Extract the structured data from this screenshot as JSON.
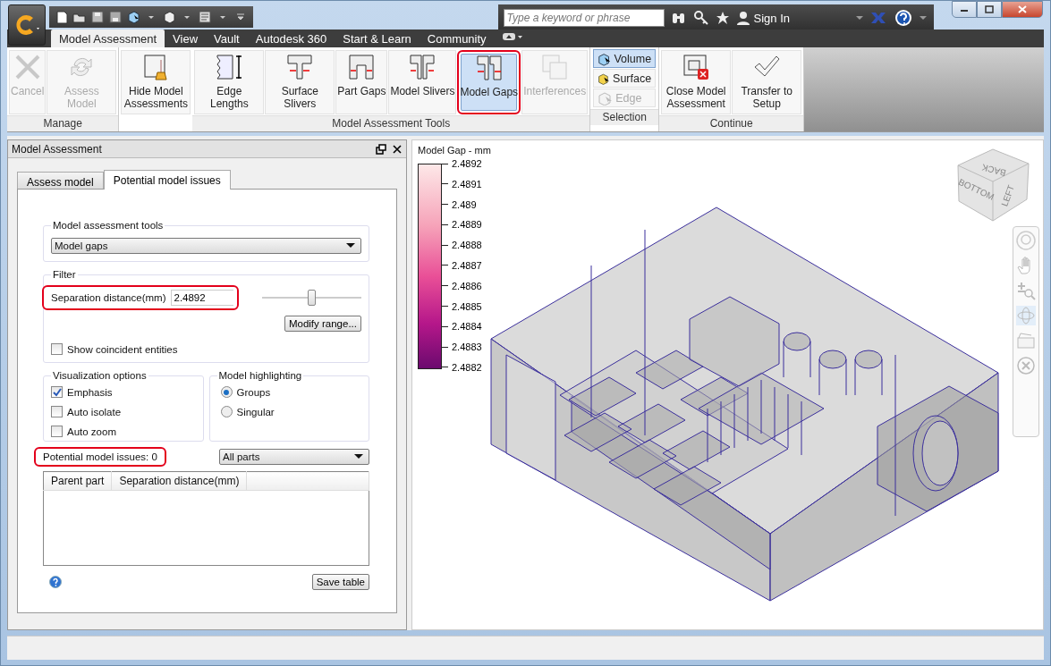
{
  "title_bar": {
    "search": {
      "placeholder": "Type a keyword or phrase"
    },
    "sign_in": "Sign In"
  },
  "ribbon_tabs": [
    {
      "label": "Model Assessment",
      "selected": true
    },
    {
      "label": "View",
      "selected": false
    },
    {
      "label": "Vault",
      "selected": false
    },
    {
      "label": "Autodesk 360",
      "selected": false
    },
    {
      "label": "Start & Learn",
      "selected": false
    },
    {
      "label": "Community",
      "selected": false
    }
  ],
  "ribbon_groups": [
    {
      "title": "Manage",
      "buttons": [
        {
          "kind": "large",
          "label": "Cancel",
          "disabled": true,
          "selected": false,
          "highlighted": false
        },
        {
          "kind": "large",
          "label": "Assess Model",
          "disabled": true,
          "selected": false,
          "highlighted": false
        }
      ]
    },
    {
      "buttons": [
        {
          "kind": "large",
          "label": "Hide Model Assessments",
          "disabled": false,
          "selected": false,
          "highlighted": false
        }
      ]
    },
    {
      "title": "Model Assessment Tools",
      "buttons": [
        {
          "kind": "large",
          "label": "Edge Lengths",
          "disabled": false,
          "selected": false,
          "highlighted": false
        },
        {
          "kind": "large",
          "label": "Surface Slivers",
          "disabled": false,
          "selected": false,
          "highlighted": false
        },
        {
          "kind": "large",
          "label": "Part Gaps",
          "disabled": false,
          "selected": false,
          "highlighted": false
        },
        {
          "kind": "large",
          "label": "Model Slivers",
          "disabled": false,
          "selected": false,
          "highlighted": false
        },
        {
          "kind": "large",
          "label": "Model Gaps",
          "disabled": false,
          "selected": true,
          "highlighted": true
        },
        {
          "kind": "large",
          "label": "Interferences",
          "disabled": true,
          "selected": false,
          "highlighted": false
        }
      ]
    },
    {
      "title": "Selection",
      "buttons": [
        {
          "kind": "small",
          "label": "Volume",
          "disabled": false,
          "selected": true,
          "highlighted": false
        },
        {
          "kind": "small",
          "label": "Surface",
          "disabled": false,
          "selected": false,
          "highlighted": false
        },
        {
          "kind": "small",
          "label": "Edge",
          "disabled": true,
          "selected": false,
          "highlighted": false
        }
      ]
    },
    {
      "title": "Continue",
      "buttons": [
        {
          "kind": "large",
          "label": "Close Model Assessment",
          "disabled": false,
          "selected": false,
          "highlighted": false
        },
        {
          "kind": "large",
          "label": "Transfer to Setup",
          "disabled": false,
          "selected": false,
          "highlighted": false
        }
      ]
    }
  ],
  "panel": {
    "title": "Model Assessment",
    "tabs": [
      {
        "label": "Assess model",
        "selected": false
      },
      {
        "label": "Potential model issues",
        "selected": true
      }
    ],
    "tools": {
      "title": "Model assessment tools",
      "value": "Model gaps"
    },
    "filter": {
      "title": "Filter",
      "field_label": "Separation distance(mm)",
      "value": "2.4892",
      "highlighted": true,
      "slider": {
        "level": 0.5
      },
      "button": "Modify range...",
      "checkbox": {
        "label": "Show coincident entities",
        "checked": false
      }
    },
    "visualization": {
      "title": "Visualization options",
      "options": [
        {
          "label": "Emphasis",
          "checked": true
        },
        {
          "label": "Auto isolate",
          "checked": false
        },
        {
          "label": "Auto zoom",
          "checked": false
        }
      ]
    },
    "highlighting": {
      "title": "Model highlighting",
      "options": [
        {
          "label": "Groups",
          "selected": true
        },
        {
          "label": "Singular",
          "selected": false
        }
      ]
    },
    "issues": {
      "label": "Potential model issues: 0",
      "highlighted": true
    },
    "parts_select": "All parts",
    "table": {
      "columns": [
        "Parent part",
        "Separation distance(mm)"
      ]
    },
    "save_button": "Save table"
  },
  "viewport": {
    "legend": {
      "title": "Model Gap - mm",
      "labels": [
        "2.4892",
        "2.4891",
        "2.489",
        "2.4889",
        "2.4888",
        "2.4887",
        "2.4886",
        "2.4885",
        "2.4884",
        "2.4883",
        "2.4882"
      ]
    },
    "view_cube": [
      "BACK",
      "BOTTOM",
      "LEFT"
    ]
  }
}
